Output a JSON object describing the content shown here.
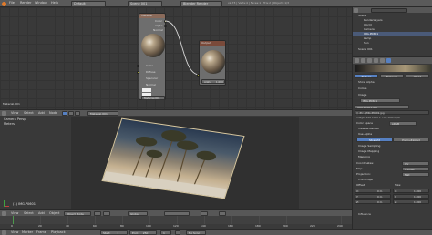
{
  "top_header": {
    "menus": [
      "File",
      "Render",
      "Window",
      "Help"
    ],
    "scene_layout": "Default",
    "scene": "Scene 001",
    "engine": "Blender Render",
    "stats": "v2.73 | Verts:4 | Faces:1 | Tris:2 | Objects:1/3"
  },
  "node_editor": {
    "node1": {
      "title": "Material",
      "outputs": [
        "Color",
        "Alpha",
        "Normal"
      ],
      "inputs": [
        "Color",
        "Diffuse",
        "Specular",
        "Normal"
      ],
      "material": "Material.001"
    },
    "node2": {
      "title": "Output",
      "alpha_label": "Alpha",
      "alpha_value": "1.000"
    },
    "footer_label": "Material.001",
    "menus": [
      "View",
      "Select",
      "Add",
      "Node"
    ],
    "material_field": "Material.001"
  },
  "viewport": {
    "label": "Camera Persp",
    "units": "Meters",
    "object_label": "(1) IMG.P0601",
    "menus": [
      "View",
      "Select",
      "Add",
      "Object"
    ],
    "mode": "Object Mode",
    "shading": "Global"
  },
  "outliner": {
    "search_placeholder": "",
    "items": [
      "Scene",
      "RenderLayers",
      "World",
      "Camera",
      "IMG.P0601",
      "Lamp",
      "Sun",
      "Scene 001"
    ]
  },
  "properties": {
    "tabs": [
      "Texture",
      "Material",
      "World"
    ],
    "texture_slot": "IMG.P0601",
    "panels": {
      "show_alpha": "Show Alpha",
      "colors": "Colors",
      "image": "Image",
      "image_name": "IMG.P0601.jpg",
      "image_path": "//..Pic..\\IMG.P0601.jpg",
      "image_info": "Image: size 1000 x 750, RGB byte",
      "color_space": "Color Space",
      "color_space_value": "sRGB",
      "view_as_render": "View as Render",
      "use_alpha": "Use Alpha",
      "alpha_mode": "Straight",
      "alpha_mode2": "Premultiplied",
      "image_sampling": "Image Sampling",
      "image_mapping": "Image Mapping",
      "mapping": "Mapping",
      "coordinates": "Coordinates:",
      "coord_value": "UV",
      "map": "Map:",
      "map_value": "UVMap",
      "projection": "Projection:",
      "proj_value": "Flat",
      "from_dupli": "From Dupli",
      "offset": "Offset:",
      "size": "Size:",
      "x": "X:",
      "y": "Y:",
      "z": "Z:",
      "offset_x": "0 m",
      "offset_y": "0 m",
      "offset_z": "0 m",
      "size_x": "1.000",
      "size_y": "1.000",
      "size_z": "1.000",
      "influence": "Influence"
    }
  },
  "timeline": {
    "menus": [
      "View",
      "Marker",
      "Frame",
      "Playback"
    ],
    "start_label": "Start:",
    "start": "1",
    "end_label": "End:",
    "end": "250",
    "current": "1",
    "sync": "No Sync",
    "ticks": [
      "0",
      "20",
      "40",
      "60",
      "80",
      "100",
      "120",
      "140",
      "160",
      "180",
      "200",
      "220",
      "240"
    ]
  },
  "colors": {
    "accent": "#5680c2",
    "bg": "#3c3c3c",
    "header": "#575757"
  }
}
